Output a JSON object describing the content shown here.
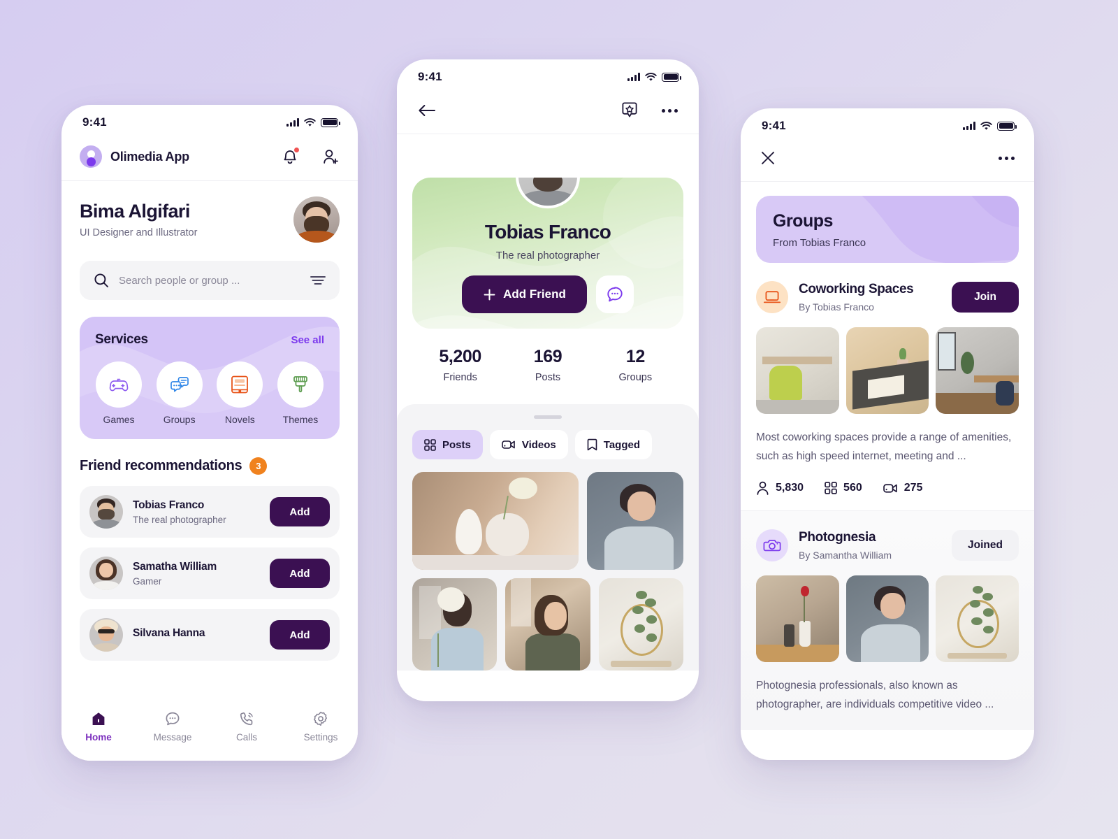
{
  "status_bar": {
    "time": "9:41"
  },
  "phone_home": {
    "app_name": "Olimedia App",
    "notification_badge": "",
    "profile": {
      "name": "Bima Algifari",
      "role": "UI Designer and Illustrator"
    },
    "search": {
      "placeholder": "Search people or group ...",
      "value": ""
    },
    "services": {
      "title": "Services",
      "see_all": "See all",
      "items": [
        {
          "label": "Games",
          "icon": "gamepad-icon"
        },
        {
          "label": "Groups",
          "icon": "chat-bubbles-icon"
        },
        {
          "label": "Novels",
          "icon": "book-icon"
        },
        {
          "label": "Themes",
          "icon": "paintbrush-icon"
        }
      ]
    },
    "friend_recommendations": {
      "title": "Friend recommendations",
      "count": "3",
      "items": [
        {
          "name": "Tobias Franco",
          "sub": "The real photographer",
          "action": "Add"
        },
        {
          "name": "Samatha William",
          "sub": "Gamer",
          "action": "Add"
        },
        {
          "name": "Silvana Hanna",
          "sub": "",
          "action": "Add"
        }
      ]
    },
    "tabs": [
      {
        "label": "Home",
        "icon": "home-icon",
        "active": true
      },
      {
        "label": "Message",
        "icon": "message-icon",
        "active": false
      },
      {
        "label": "Calls",
        "icon": "phone-icon",
        "active": false
      },
      {
        "label": "Settings",
        "icon": "gear-icon",
        "active": false
      }
    ]
  },
  "phone_profile": {
    "name": "Tobias Franco",
    "role": "The real photographer",
    "add_friend_label": "Add Friend",
    "stats": [
      {
        "value": "5,200",
        "label": "Friends"
      },
      {
        "value": "169",
        "label": "Posts"
      },
      {
        "value": "12",
        "label": "Groups"
      }
    ],
    "chips": [
      {
        "label": "Posts",
        "icon": "grid-icon",
        "active": true
      },
      {
        "label": "Videos",
        "icon": "video-icon",
        "active": false
      },
      {
        "label": "Tagged",
        "icon": "bookmark-icon",
        "active": false
      }
    ]
  },
  "phone_groups": {
    "banner": {
      "title": "Groups",
      "subtitle": "From Tobias Franco"
    },
    "groups": [
      {
        "name": "Coworking Spaces",
        "by": "By Tobias Franco",
        "action": "Join",
        "joined": false,
        "icon": "laptop-icon",
        "description": "Most coworking spaces provide a range of amenities, such as high speed internet, meeting and ...",
        "stats": [
          {
            "icon": "person-icon",
            "value": "5,830"
          },
          {
            "icon": "grid-icon",
            "value": "560"
          },
          {
            "icon": "video-icon",
            "value": "275"
          }
        ]
      },
      {
        "name": "Photognesia",
        "by": "By Samantha William",
        "action": "Joined",
        "joined": true,
        "icon": "camera-icon",
        "description": "Photognesia professionals, also known as photographer, are individuals competitive video ...",
        "stats": []
      }
    ]
  },
  "colors": {
    "dark_purple": "#3b1052",
    "accent_purple": "#7c3aed",
    "lavender": "#ddd0f8",
    "badge_orange": "#f0821e",
    "notification_red": "#f05252",
    "text_dark": "#1b1434",
    "text_muted": "#6b6880"
  }
}
